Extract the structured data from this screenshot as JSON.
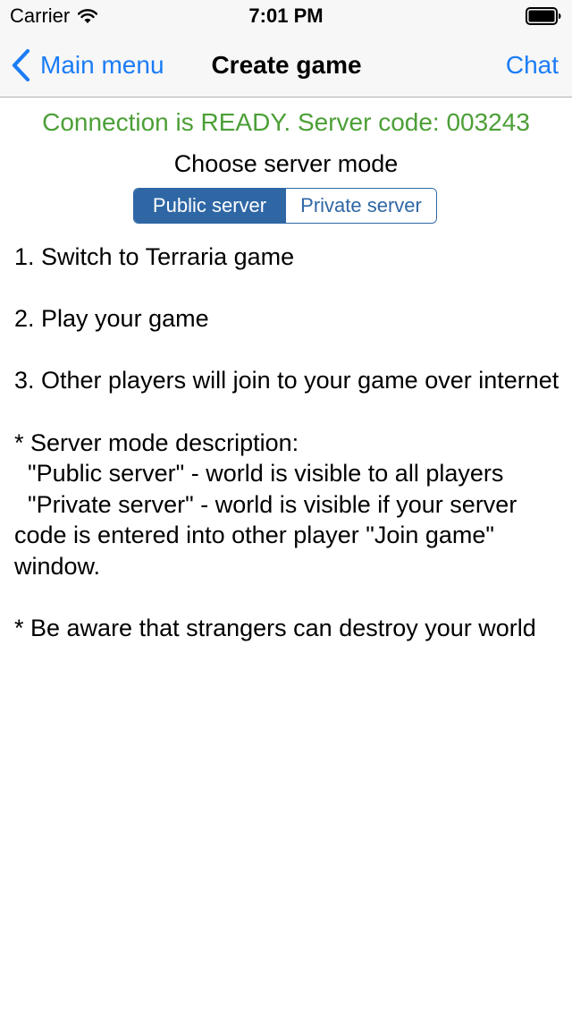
{
  "status_bar": {
    "carrier": "Carrier",
    "time": "7:01 PM",
    "wifi_icon": "wifi-icon",
    "battery_icon": "battery-icon"
  },
  "nav": {
    "back_label": "Main menu",
    "back_icon": "chevron-left-icon",
    "title": "Create game",
    "chat_label": "Chat"
  },
  "connection": {
    "status_text": "Connection is READY. Server code: 003243"
  },
  "server_mode": {
    "heading": "Choose server mode",
    "options": [
      {
        "label": "Public server",
        "selected": true
      },
      {
        "label": "Private server",
        "selected": false
      }
    ]
  },
  "instructions": {
    "step1": "1. Switch to Terraria game",
    "step2": "2. Play your game",
    "step3": "3. Other players will join to your game over internet",
    "mode_description_title": "* Server mode description:",
    "public_description": "  \"Public server\" - world is visible to all players",
    "private_description": "  \"Private server\" - world is visible if your server code is entered into other player \"Join game\" window.",
    "warning": "* Be aware that strangers can destroy your world"
  },
  "colors": {
    "accent": "#1b7cf6",
    "status_green": "#4c9f37",
    "segment_blue": "#2f67a5",
    "bar_background": "#f7f7f7"
  }
}
